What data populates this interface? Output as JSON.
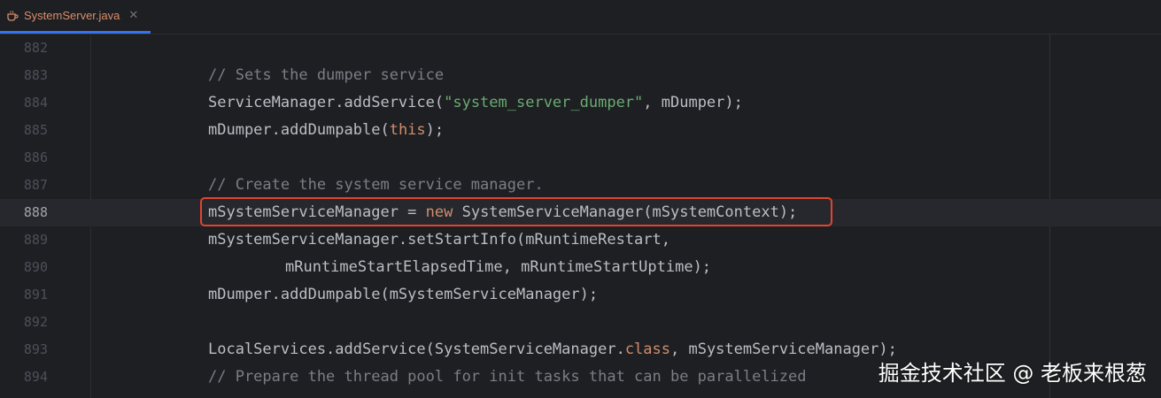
{
  "tab": {
    "label": "SystemServer.java",
    "icon": "java-file-icon",
    "close": "✕"
  },
  "lines": [
    {
      "number": "882",
      "segments": []
    },
    {
      "number": "883",
      "segments": [
        {
          "text": "// Sets the dumper service",
          "type": "comment"
        }
      ]
    },
    {
      "number": "884",
      "segments": [
        {
          "text": "ServiceManager.addService(",
          "type": "plain"
        },
        {
          "text": "\"system_server_dumper\"",
          "type": "string"
        },
        {
          "text": ", mDumper);",
          "type": "plain"
        }
      ]
    },
    {
      "number": "885",
      "segments": [
        {
          "text": "mDumper.addDumpable(",
          "type": "plain"
        },
        {
          "text": "this",
          "type": "keyword"
        },
        {
          "text": ");",
          "type": "plain"
        }
      ]
    },
    {
      "number": "886",
      "segments": []
    },
    {
      "number": "887",
      "segments": [
        {
          "text": "// Create the system service manager.",
          "type": "comment"
        }
      ]
    },
    {
      "number": "888",
      "current": true,
      "segments": [
        {
          "text": "mSystemServiceManager = ",
          "type": "plain"
        },
        {
          "text": "new",
          "type": "keyword"
        },
        {
          "text": " SystemServiceManager(mSystemContext);",
          "type": "plain"
        }
      ]
    },
    {
      "number": "889",
      "segments": [
        {
          "text": "mSystemServiceManager.setStartInfo(mRuntimeRestart,",
          "type": "plain"
        }
      ]
    },
    {
      "number": "890",
      "indent": 2,
      "segments": [
        {
          "text": "mRuntimeStartElapsedTime, mRuntimeStartUptime);",
          "type": "plain"
        }
      ]
    },
    {
      "number": "891",
      "segments": [
        {
          "text": "mDumper.addDumpable(mSystemServiceManager);",
          "type": "plain"
        }
      ]
    },
    {
      "number": "892",
      "segments": []
    },
    {
      "number": "893",
      "segments": [
        {
          "text": "LocalServices.addService(SystemServiceManager.",
          "type": "plain"
        },
        {
          "text": "class",
          "type": "keyword"
        },
        {
          "text": ", mSystemServiceManager);",
          "type": "plain"
        }
      ]
    },
    {
      "number": "894",
      "segments": [
        {
          "text": "// Prepare the thread pool for init tasks that can be parallelized",
          "type": "comment"
        }
      ]
    }
  ],
  "watermark": "掘金技术社区 @ 老板来根葱",
  "colors": {
    "accent": "#3574f0",
    "highlight_border": "#e0452f",
    "comment": "#7a7e85",
    "string": "#6aab73",
    "keyword": "#cf8e6d"
  }
}
